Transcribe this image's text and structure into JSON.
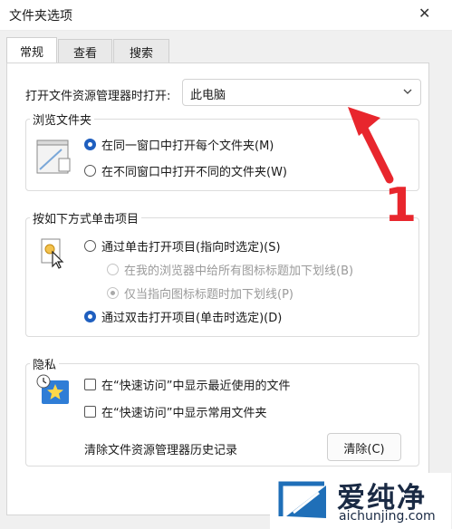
{
  "window": {
    "title": "文件夹选项",
    "close_label": "✕"
  },
  "tabs": [
    {
      "label": "常规",
      "active": true
    },
    {
      "label": "查看",
      "active": false
    },
    {
      "label": "搜索",
      "active": false
    }
  ],
  "open_explorer": {
    "label": "打开文件资源管理器时打开:",
    "value": "此电脑"
  },
  "browse": {
    "title": "浏览文件夹",
    "options": [
      {
        "label": "在同一窗口中打开每个文件夹(M)",
        "selected": true
      },
      {
        "label": "在不同窗口中打开不同的文件夹(W)",
        "selected": false
      }
    ]
  },
  "click": {
    "title": "按如下方式单击项目",
    "single": {
      "label": "通过单击打开项目(指向时选定)(S)",
      "selected": false
    },
    "underline_browser": {
      "label": "在我的浏览器中给所有图标标题加下划线(B)",
      "selected": false
    },
    "underline_point": {
      "label": "仅当指向图标标题时加下划线(P)",
      "selected": true
    },
    "double": {
      "label": "通过双击打开项目(单击时选定)(D)",
      "selected": true
    }
  },
  "privacy": {
    "title": "隐私",
    "recent_files": {
      "label": "在“快速访问”中显示最近使用的文件",
      "checked": false
    },
    "frequent_folders": {
      "label": "在“快速访问”中显示常用文件夹",
      "checked": false
    },
    "clear_label": "清除文件资源管理器历史记录",
    "clear_button": "清除(C)"
  },
  "annotation": {
    "number": "1",
    "color": "#e8262d"
  },
  "watermark": {
    "brand": "爱纯净",
    "url": "aichunjing.com",
    "color": "#1f6fb8"
  },
  "colors": {
    "accent": "#1f5fbf"
  }
}
